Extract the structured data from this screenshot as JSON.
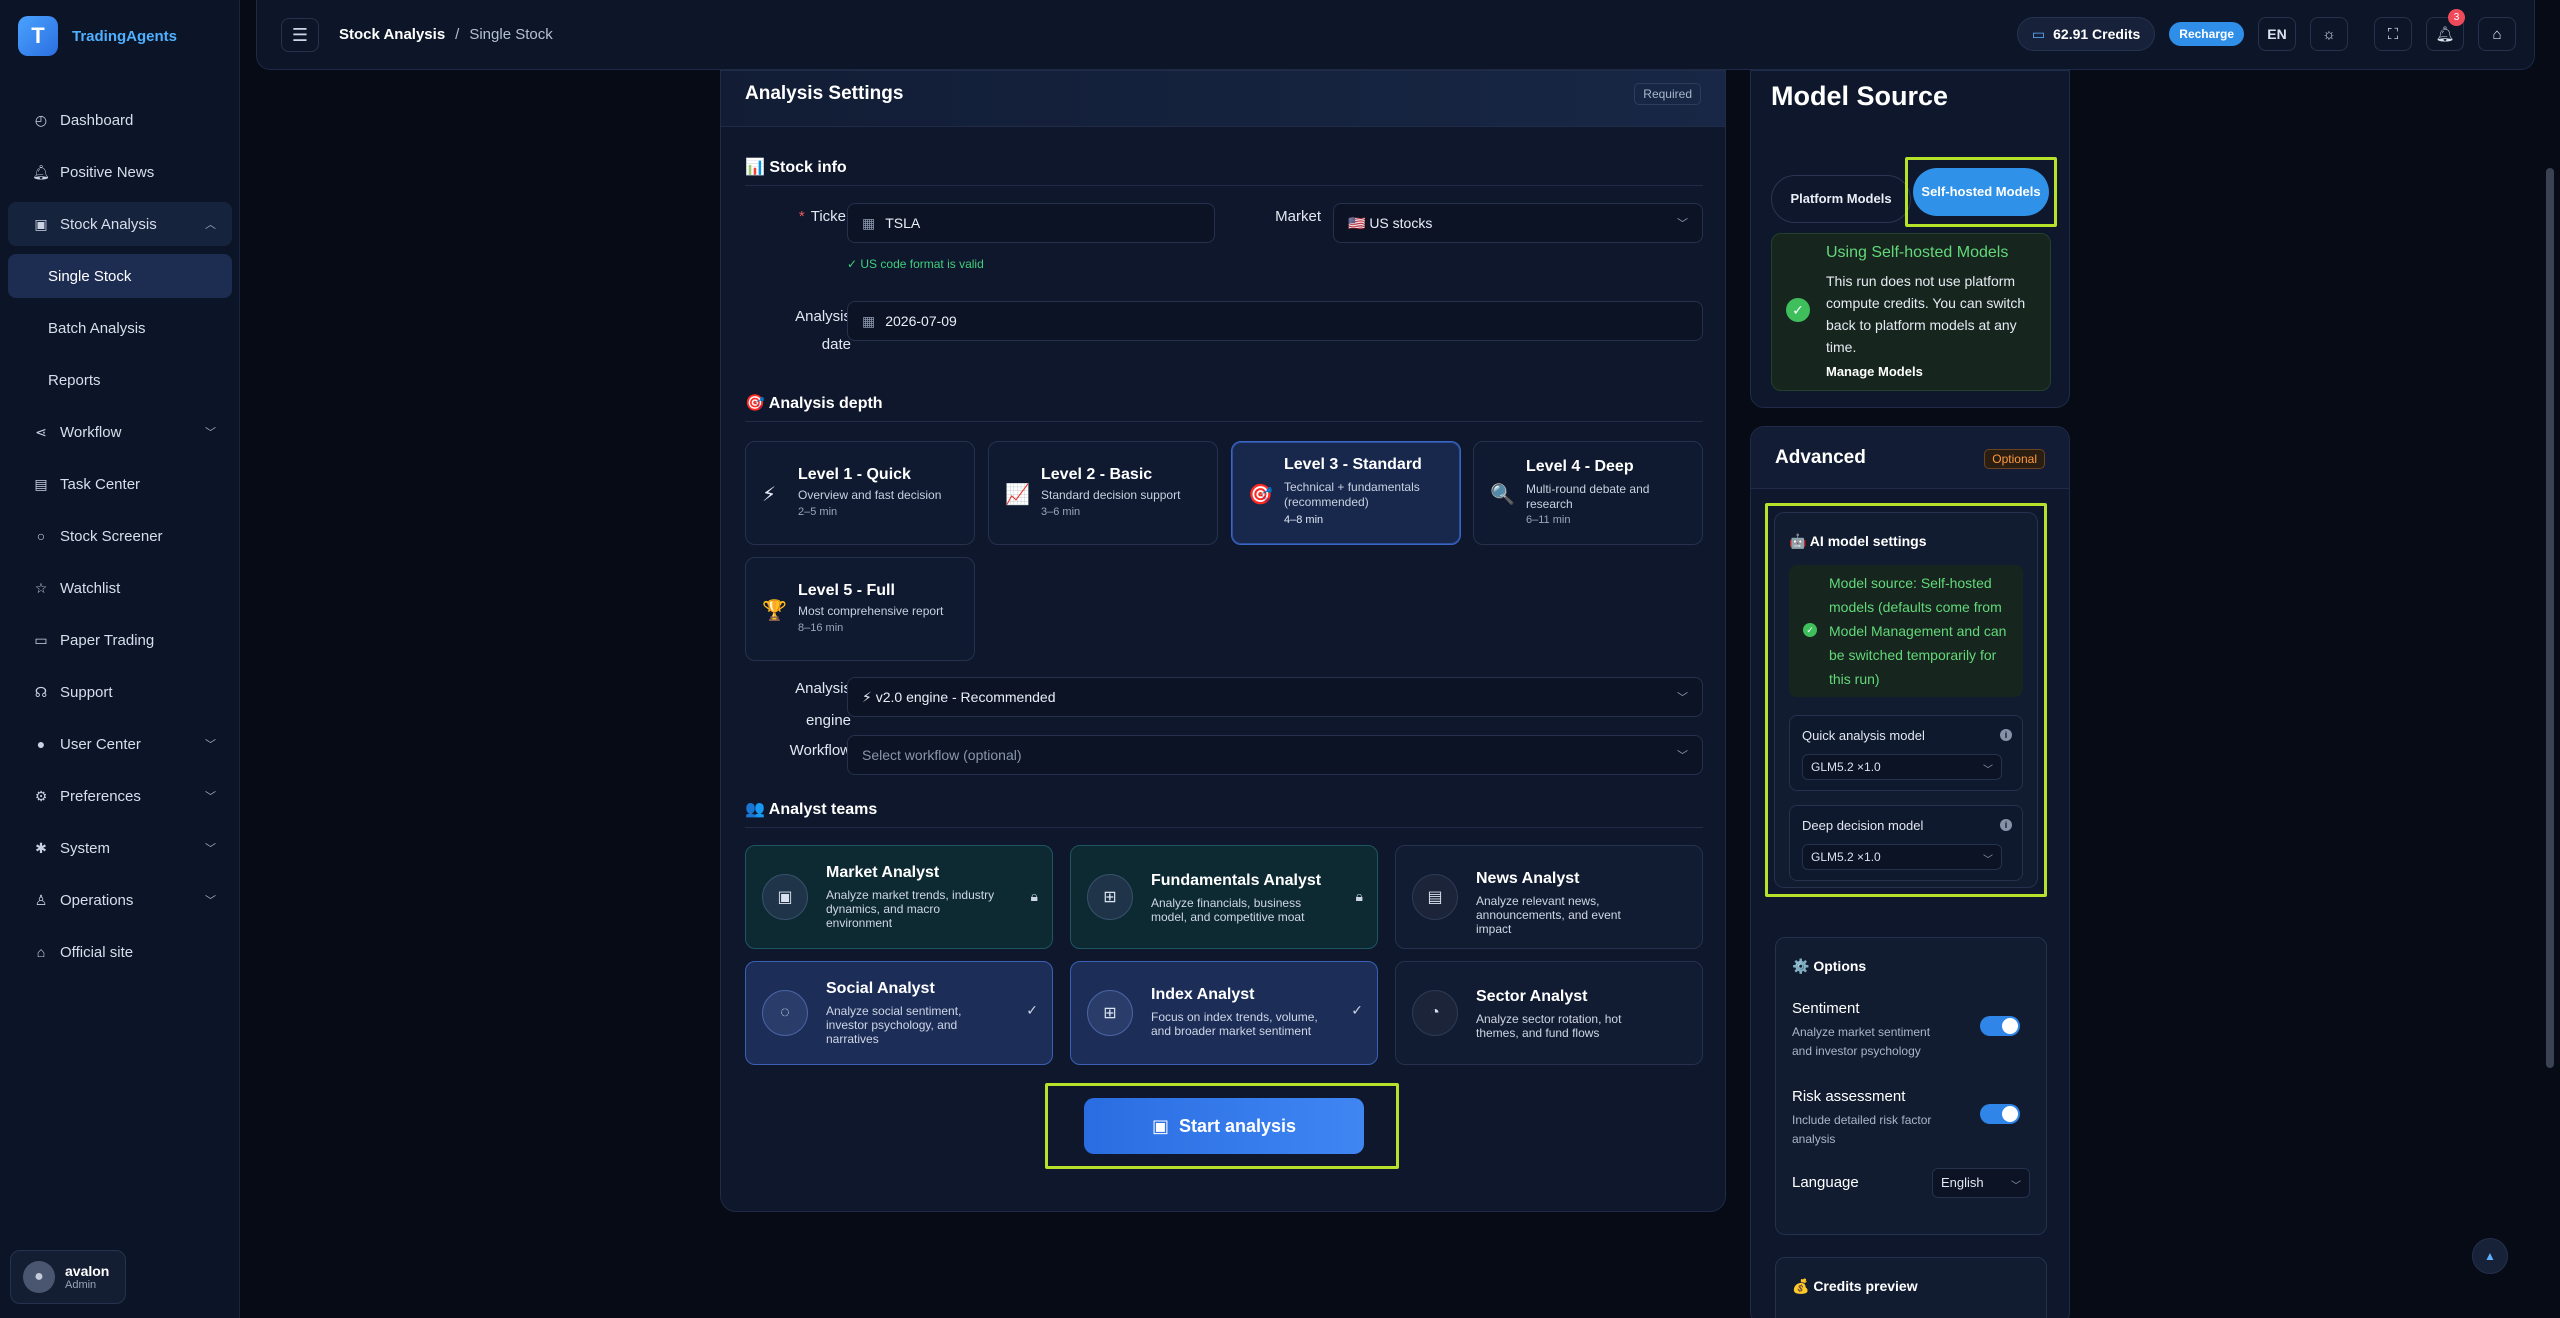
{
  "brand": {
    "logo_letter": "T",
    "name": "TradingAgents"
  },
  "sidebar": {
    "items": [
      {
        "label": "Dashboard",
        "icon": "dashboard-icon"
      },
      {
        "label": "Positive News",
        "icon": "bell-icon"
      },
      {
        "label": "Stock Analysis",
        "icon": "chart-icon",
        "expanded": true
      },
      {
        "label": "Single Stock",
        "active": true
      },
      {
        "label": "Batch Analysis"
      },
      {
        "label": "Reports"
      },
      {
        "label": "Workflow",
        "icon": "share-icon"
      },
      {
        "label": "Task Center",
        "icon": "list-icon"
      },
      {
        "label": "Stock Screener",
        "icon": "search-icon"
      },
      {
        "label": "Watchlist",
        "icon": "star-icon"
      },
      {
        "label": "Paper Trading",
        "icon": "wallet-icon"
      },
      {
        "label": "Support",
        "icon": "headset-icon"
      },
      {
        "label": "User Center",
        "icon": "user-icon"
      },
      {
        "label": "Preferences",
        "icon": "gear-icon"
      },
      {
        "label": "System",
        "icon": "cog-icon"
      },
      {
        "label": "Operations",
        "icon": "person-icon"
      },
      {
        "label": "Official site",
        "icon": "home-icon"
      }
    ]
  },
  "user": {
    "name": "avalon",
    "role": "Admin"
  },
  "header": {
    "breadcrumb": {
      "section": "Stock Analysis",
      "separator": "/",
      "page": "Single Stock"
    },
    "credits": "62.91 Credits",
    "recharge_label": "Recharge",
    "language": "EN",
    "notification_count": "3"
  },
  "settings": {
    "title": "Analysis Settings",
    "required_tag": "Required",
    "stock_info_title": "📊 Stock info",
    "ticker_label": "Ticker",
    "ticker_value": "TSLA",
    "market_label": "Market",
    "market_value": "🇺🇸 US stocks",
    "ticker_valid_msg": "✓ US code format is valid",
    "date_label_1": "Analysis",
    "date_label_2": "date",
    "date_value": "2026-07-09",
    "depth_title": "🎯 Analysis depth",
    "depth_levels": [
      {
        "title": "Level 1 - Quick",
        "desc": "Overview and fast decision",
        "time": "2–5 min",
        "icon": "⚡"
      },
      {
        "title": "Level 2 - Basic",
        "desc": "Standard decision support",
        "time": "3–6 min",
        "icon": "📈"
      },
      {
        "title": "Level 3 - Standard",
        "desc": "Technical + fundamentals (recommended)",
        "time": "4–8 min",
        "icon": "🎯",
        "selected": true
      },
      {
        "title": "Level 4 - Deep",
        "desc": "Multi-round debate and research",
        "time": "6–11 min",
        "icon": "🔍"
      },
      {
        "title": "Level 5 - Full",
        "desc": "Most comprehensive report",
        "time": "8–16 min",
        "icon": "🏆"
      }
    ],
    "engine_label_1": "Analysis",
    "engine_label_2": "engine",
    "engine_value": "⚡ v2.0 engine - Recommended",
    "workflow_label": "Workflow",
    "workflow_placeholder": "Select workflow (optional)",
    "teams_title": "👥 Analyst teams",
    "teams": [
      {
        "title": "Market Analyst",
        "desc": "Analyze market trends, industry dynamics, and macro environment",
        "state": "locked"
      },
      {
        "title": "Fundamentals Analyst",
        "desc": "Analyze financials, business model, and competitive moat",
        "state": "locked"
      },
      {
        "title": "News Analyst",
        "desc": "Analyze relevant news, announcements, and event impact",
        "state": "plain"
      },
      {
        "title": "Social Analyst",
        "desc": "Analyze social sentiment, investor psychology, and narratives",
        "state": "checked"
      },
      {
        "title": "Index Analyst",
        "desc": "Focus on index trends, volume, and broader market sentiment",
        "state": "checked"
      },
      {
        "title": "Sector Analyst",
        "desc": "Analyze sector rotation, hot themes, and fund flows",
        "state": "plain"
      }
    ],
    "start_label": "Start analysis"
  },
  "model_source": {
    "title": "Model Source",
    "platform_label": "Platform Models",
    "self_hosted_label": "Self-hosted Models",
    "using_title": "Using Self-hosted Models",
    "using_desc": "This run does not use platform compute credits. You can switch back to platform models at any time.",
    "manage_label": "Manage Models"
  },
  "advanced": {
    "title": "Advanced",
    "optional_tag": "Optional",
    "ai_title": "🤖 AI model settings",
    "source_text": "Model source: Self-hosted models (defaults come from Model Management and can be switched temporarily for this run)",
    "quick_label": "Quick analysis model",
    "quick_value": "GLM5.2 ×1.0",
    "deep_label": "Deep decision model",
    "deep_value": "GLM5.2 ×1.0",
    "options_title": "⚙️ Options",
    "sentiment_label": "Sentiment",
    "sentiment_desc": "Analyze market sentiment and investor psychology",
    "sentiment_on": true,
    "risk_label": "Risk assessment",
    "risk_desc": "Include detailed risk factor analysis",
    "risk_on": true,
    "language_label": "Language",
    "language_value": "English",
    "credits_preview_title": "💰 Credits preview"
  },
  "colors": {
    "accent": "#2f92e8",
    "highlight": "#b6e22a",
    "success": "#3fbf5c"
  }
}
